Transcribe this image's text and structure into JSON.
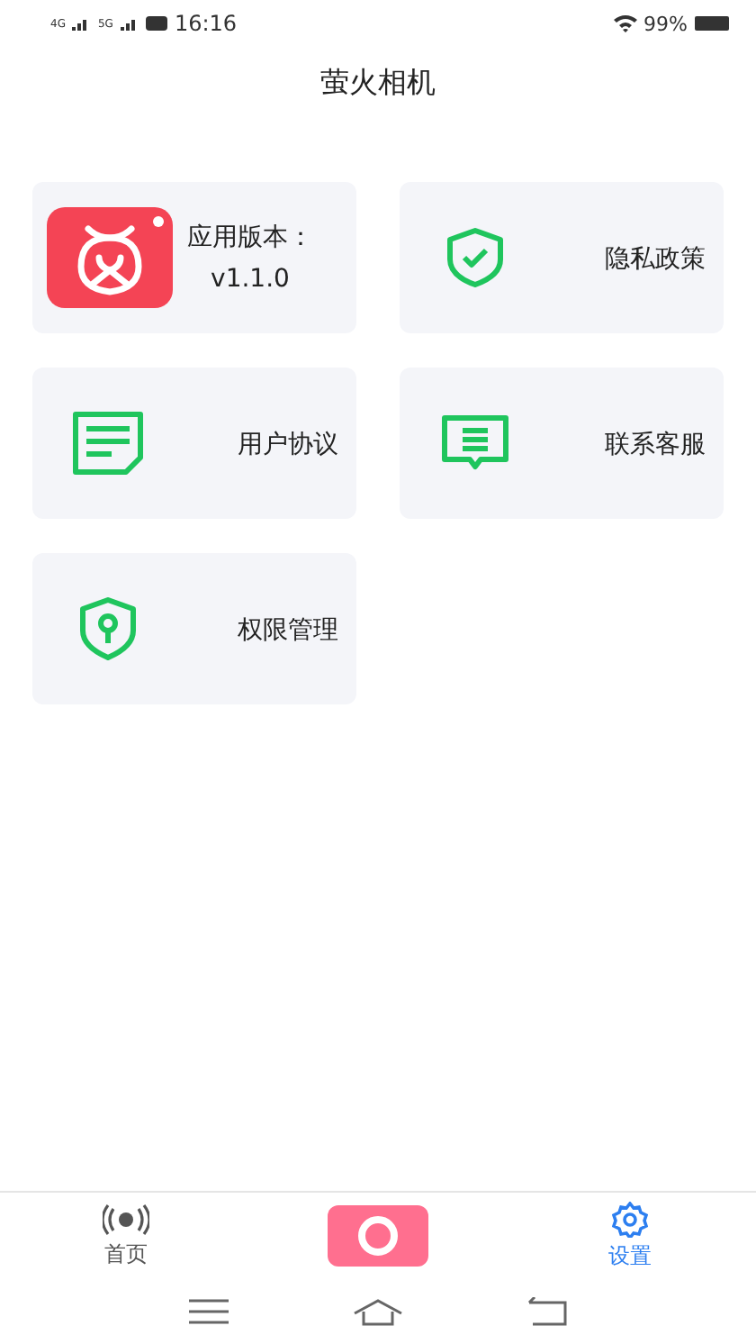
{
  "status_bar": {
    "signal_1": "4G",
    "signal_2": "5G",
    "time": "16:16",
    "battery": "99%"
  },
  "title": "萤火相机",
  "tiles": [
    {
      "kind": "app",
      "label": "应用版本：",
      "value": "v1.1.0"
    },
    {
      "kind": "shield-check",
      "label": "隐私政策"
    },
    {
      "kind": "document",
      "label": "用户协议"
    },
    {
      "kind": "chat",
      "label": "联系客服"
    },
    {
      "kind": "shield-key",
      "label": "权限管理"
    }
  ],
  "tabs": [
    {
      "kind": "home",
      "label": "首页",
      "selected": false
    },
    {
      "kind": "camera",
      "selected": false
    },
    {
      "kind": "settings",
      "label": "设置",
      "selected": true
    }
  ]
}
